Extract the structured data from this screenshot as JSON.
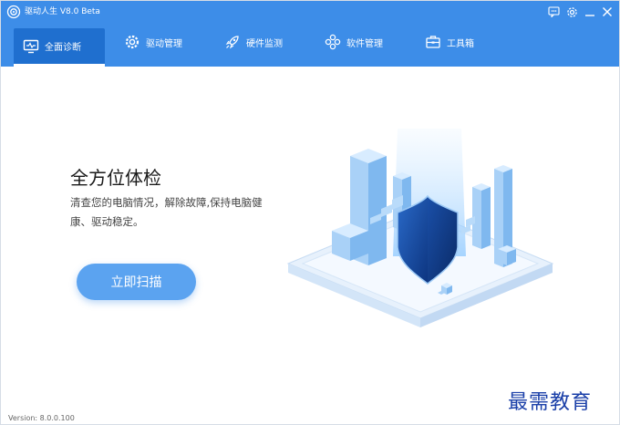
{
  "titlebar": {
    "title": "驱动人生 V8.0 Beta",
    "icons": [
      "app-logo-icon",
      "feedback-icon",
      "settings-icon",
      "minimize-icon",
      "close-icon"
    ]
  },
  "nav": {
    "tabs": [
      {
        "label": "全面诊断",
        "icon": "monitor-icon",
        "active": true
      },
      {
        "label": "驱动管理",
        "icon": "gear-icon",
        "active": false
      },
      {
        "label": "硬件监测",
        "icon": "rocket-icon",
        "active": false
      },
      {
        "label": "软件管理",
        "icon": "apps-icon",
        "active": false
      },
      {
        "label": "工具箱",
        "icon": "toolbox-icon",
        "active": false
      }
    ]
  },
  "main": {
    "headline": "全方位体检",
    "description": "清查您的电脑情况，解除故障,保持电脑健康、驱动稳定。",
    "scan_button": "立即扫描"
  },
  "footer": {
    "version": "Version:  8.0.0.100"
  },
  "watermark": "最需教育",
  "colors": {
    "brand_blue": "#3d8de8",
    "active_tab": "#1f6fcf",
    "button": "#5ba3f0",
    "shield_dark": "#123f8f"
  }
}
